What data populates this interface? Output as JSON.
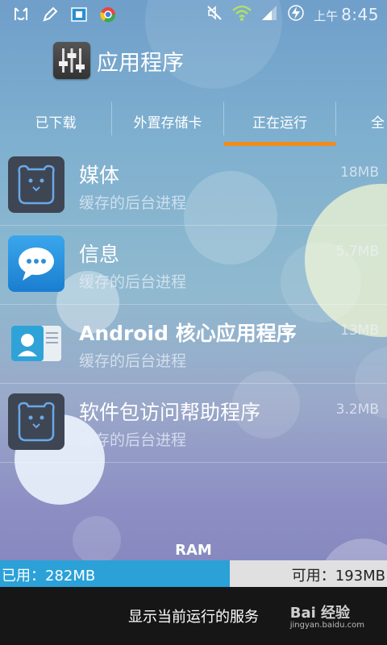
{
  "status_bar": {
    "ampm": "上午",
    "time": "8:45",
    "left_icons": [
      "notification-icon",
      "pen-icon",
      "film-icon",
      "chrome-icon"
    ],
    "right_icons": [
      "mute-icon",
      "wifi-icon",
      "signal-icon",
      "charging-icon"
    ]
  },
  "header": {
    "title": "应用程序",
    "icon": "equalizer-settings-icon"
  },
  "tabs": [
    {
      "label": "已下载",
      "selected": false
    },
    {
      "label": "外置存储卡",
      "selected": false
    },
    {
      "label": "正在运行",
      "selected": true
    },
    {
      "label": "全",
      "selected": false
    }
  ],
  "colors": {
    "accent": "#f08c1c",
    "ram_used": "#2ba1d8",
    "bottom_bar": "#161616"
  },
  "processes": [
    {
      "name": "媒体",
      "subtitle": "缓存的后台进程",
      "size": "18MB",
      "icon": "bear-media-icon"
    },
    {
      "name": "信息",
      "subtitle": "缓存的后台进程",
      "size": "5.7MB",
      "icon": "messages-icon"
    },
    {
      "name": "Android 核心应用程序",
      "subtitle": "缓存的后台进程",
      "size": "13MB",
      "icon": "contacts-icon"
    },
    {
      "name": "软件包访问帮助程序",
      "subtitle": "缓存的后台进程",
      "size": "3.2MB",
      "icon": "bear-package-icon"
    }
  ],
  "ram": {
    "label": "RAM",
    "used": "已用：282MB",
    "free": "可用：193MB",
    "used_fraction": 0.594
  },
  "bottom": {
    "button_label": "显示当前运行的服务",
    "watermark": "Bai 经验",
    "watermark_url": "jingyan.baidu.com"
  }
}
